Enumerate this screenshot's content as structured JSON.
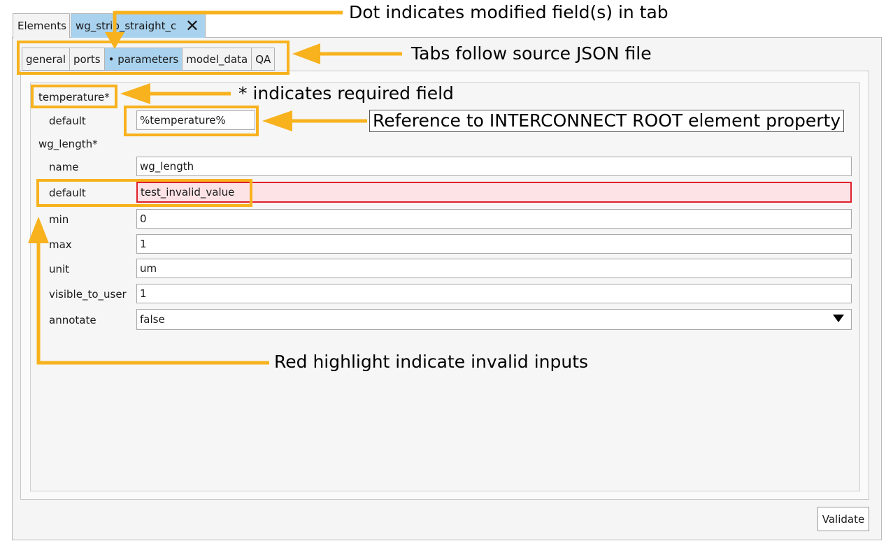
{
  "tabs": {
    "elements_label": "Elements",
    "file_label": "wg_strip_straight_c",
    "close_glyph": "✕"
  },
  "sub_tabs": [
    {
      "label": "general",
      "active": false
    },
    {
      "label": "ports",
      "active": false
    },
    {
      "label": "• parameters",
      "active": true
    },
    {
      "label": "model_data",
      "active": false
    },
    {
      "label": "QA",
      "active": false
    }
  ],
  "form": {
    "temperature": {
      "heading": "temperature*",
      "default_label": "default",
      "default_value": "%temperature%"
    },
    "wg_length": {
      "heading": "wg_length*",
      "name_label": "name",
      "name_value": "wg_length",
      "default_label": "default",
      "default_value": "test_invalid_value",
      "min_label": "min",
      "min_value": "0",
      "max_label": "max",
      "max_value": "1",
      "unit_label": "unit",
      "unit_value": "um",
      "visible_label": "visible_to_user",
      "visible_value": "1",
      "annotate_label": "annotate",
      "annotate_value": "false"
    }
  },
  "buttons": {
    "validate_label": "Validate"
  },
  "annotations": {
    "dot": "Dot indicates modified field(s) in tab",
    "tabs_source": "Tabs follow source JSON file",
    "required": "* indicates required field",
    "reference": "Reference to INTERCONNECT ROOT element property",
    "invalid": "Red highlight indicate invalid inputs"
  },
  "colors": {
    "annotation_accent": "#f7b21e",
    "active_tab": "#a9d2ee",
    "invalid_border": "#e0202a",
    "invalid_fill": "#fde3e6"
  },
  "icons": {
    "close": "close-icon",
    "dropdown": "chevron-down-icon"
  }
}
